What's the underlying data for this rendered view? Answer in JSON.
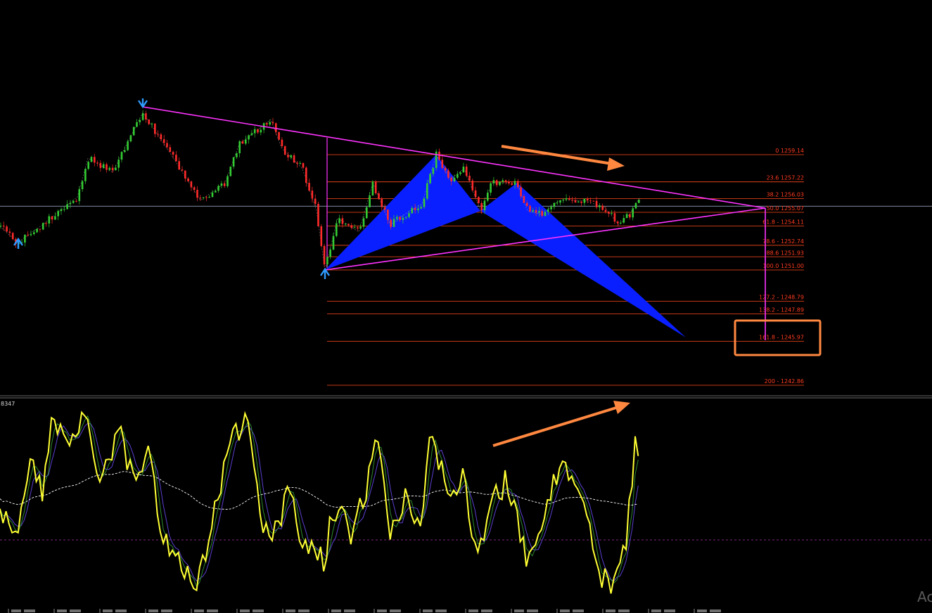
{
  "colors": {
    "background": "#000000",
    "bull_candle": "#33cc33",
    "bear_candle": "#ff2a2a",
    "fib_line": "#ff4a1c",
    "fib_label": "#ff3b1f",
    "triangle": "#ff33ff",
    "harmonic_fill": "#0a1fff",
    "arrow": "#ff8840",
    "stoch_main": "#ffff33",
    "stoch_signal_green": "#2e8b2e",
    "stoch_signal_purple": "#5b3fd0",
    "stoch_ma": "#ffffff",
    "stoch_level": "#aa33aa",
    "price_line": "#8fa0b8",
    "highlight_box": "#ff8840"
  },
  "icons": {
    "swing_high_marker": "arrow-down-icon",
    "swing_low_marker": "arrow-up-icon"
  },
  "chart_data": [
    {
      "type": "candlestick",
      "fib_levels": [
        {
          "label": "0 1259.14",
          "price": 1259.14
        },
        {
          "label": "23.6 1257.22",
          "price": 1257.22
        },
        {
          "label": "38.2 1256.03",
          "price": 1256.03
        },
        {
          "label": "50.0 1255.07",
          "price": 1255.07
        },
        {
          "label": "61.8 - 1254.11",
          "price": 1254.11
        },
        {
          "label": "78.6 - 1252.74",
          "price": 1252.74
        },
        {
          "label": "88.6 1251.93",
          "price": 1251.93
        },
        {
          "label": "100.0 1251.00",
          "price": 1251.0
        },
        {
          "label": "127.2 - 1248.79",
          "price": 1248.79
        },
        {
          "label": "138.2 - 1247.89",
          "price": 1247.89
        },
        {
          "label": "161.8 - 1245.97",
          "price": 1245.97
        },
        {
          "label": "200 - 1242.86",
          "price": 1242.86
        }
      ],
      "current_price": 1255.5
    },
    {
      "type": "line",
      "indicator_label": "8347",
      "levels": [
        20
      ]
    }
  ],
  "watermark": "Ac"
}
